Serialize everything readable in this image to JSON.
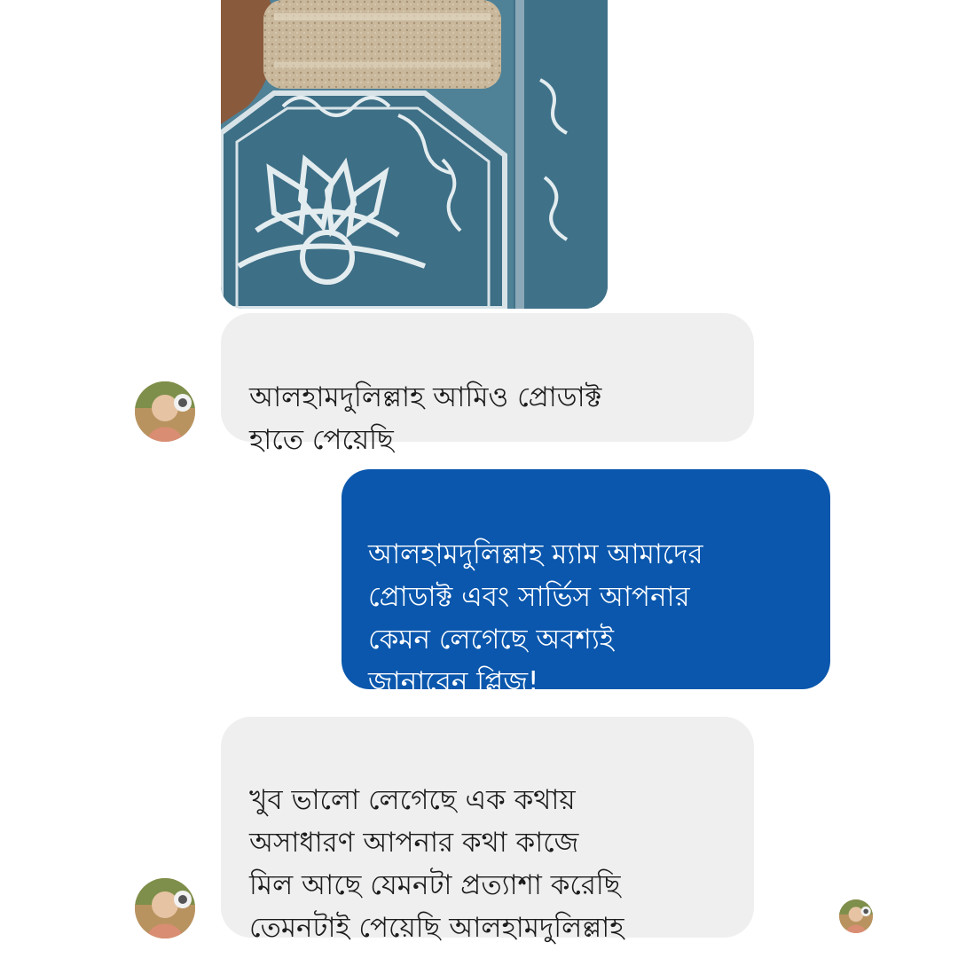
{
  "conversation": {
    "messages": [
      {
        "sender": "customer",
        "text": "আলহামদুলিল্লাহ আমিও প্রোডাক্ট\nহাতে পেয়েছি"
      },
      {
        "sender": "seller",
        "text": "আলহামদুলিল্লাহ ম্যাম আমাদের\nপ্রোডাক্ট এবং সার্ভিস আপনার\nকেমন লেগেছে অবশ্যই\nজানাবেন প্লিজ!"
      },
      {
        "sender": "customer",
        "text": "খুব ভালো লেগেছে এক কথায়\nঅসাধারণ আপনার কথা কাজে\nমিল আছে যেমনটা প্রত্যাশা করেছি\nতেমনটাই পেয়েছি আলহামদুলিল্লাহ"
      }
    ]
  },
  "colors": {
    "incoming_bubble": "#efefef",
    "outgoing_bubble": "#0a57ad",
    "incoming_text": "#1c1c1c",
    "outgoing_text": "#ffffff",
    "background": "#ffffff"
  },
  "icons": {
    "avatar": "customer-avatar-icon",
    "seen_receipt": "seen-receipt-avatar-icon"
  }
}
